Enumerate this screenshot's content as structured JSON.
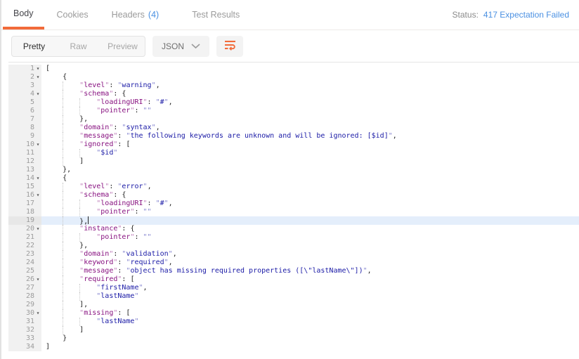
{
  "tabs": {
    "items": [
      {
        "label": "Body",
        "active": true
      },
      {
        "label": "Cookies",
        "active": false
      },
      {
        "label": "Headers",
        "badge": "(4)",
        "active": false
      },
      {
        "label": "Test Results",
        "active": false
      }
    ],
    "status_label": "Status:",
    "status_value": "417 Expectation Failed"
  },
  "toolbar": {
    "view_modes": [
      "Pretty",
      "Raw",
      "Preview"
    ],
    "active_mode": "Pretty",
    "language_select": "JSON",
    "icons": [
      "chevron-down-icon",
      "wrap-text-icon"
    ]
  },
  "editor": {
    "active_line": 19,
    "folded_lines": [
      1,
      2,
      4,
      10,
      14,
      16,
      20,
      26,
      30
    ],
    "lines": [
      "[",
      "    {",
      "        \"level\": \"warning\",",
      "        \"schema\": {",
      "            \"loadingURI\": \"#\",",
      "            \"pointer\": \"\"",
      "        },",
      "        \"domain\": \"syntax\",",
      "        \"message\": \"the following keywords are unknown and will be ignored: [$id]\",",
      "        \"ignored\": [",
      "            \"$id\"",
      "        ]",
      "    },",
      "    {",
      "        \"level\": \"error\",",
      "        \"schema\": {",
      "            \"loadingURI\": \"#\",",
      "            \"pointer\": \"\"",
      "        },",
      "        \"instance\": {",
      "            \"pointer\": \"\"",
      "        },",
      "        \"domain\": \"validation\",",
      "        \"keyword\": \"required\",",
      "        \"message\": \"object has missing required properties ([\\\"lastName\\\"])\",",
      "        \"required\": [",
      "            \"firstName\",",
      "            \"lastName\"",
      "        ],",
      "        \"missing\": [",
      "            \"lastName\"",
      "        ]",
      "    }",
      "]"
    ]
  },
  "colors": {
    "accent_orange": "#f26b3a",
    "link_blue": "#4a90e2",
    "json_key": "#881280",
    "json_string": "#1a1aa6",
    "active_line_bg": "#e4eefb"
  }
}
